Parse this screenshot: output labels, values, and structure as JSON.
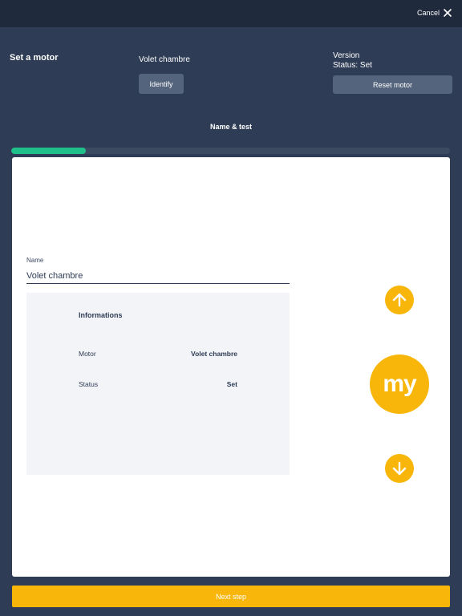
{
  "topbar": {
    "cancel_label": "Cancel"
  },
  "header": {
    "title": "Set a motor",
    "motor_name": "Volet chambre",
    "identify_label": "Identify",
    "version_label": "Version",
    "status_line": "Status: Set",
    "reset_label": "Reset motor"
  },
  "step": {
    "title": "Name & test",
    "progress": 0.17
  },
  "form": {
    "name_label": "Name",
    "name_value": "Volet chambre"
  },
  "info": {
    "title": "Informations",
    "rows": [
      {
        "label": "Motor",
        "value": "Volet chambre"
      },
      {
        "label": "Status",
        "value": "Set"
      }
    ]
  },
  "controls": {
    "my_label": "my"
  },
  "footer": {
    "next_label": "Next step"
  },
  "colors": {
    "accent": "#f9b60a",
    "progress": "#20c08b",
    "background": "#2e3c55",
    "topbar": "#1f2b3c"
  }
}
